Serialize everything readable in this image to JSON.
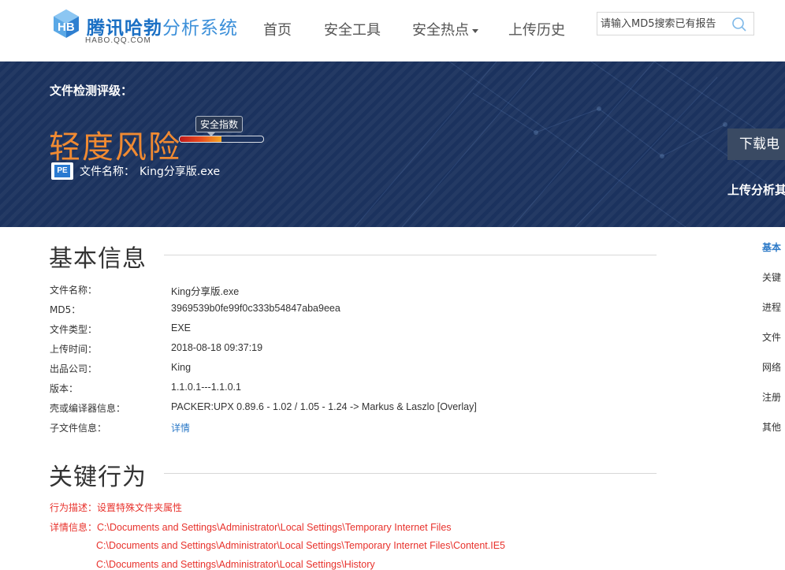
{
  "brand": {
    "title_a": "腾讯哈勃",
    "title_b": "分析系统",
    "subtitle": "HABO.QQ.COM"
  },
  "nav": {
    "items": [
      "首页",
      "安全工具",
      "安全热点",
      "上传历史"
    ]
  },
  "search": {
    "placeholder": "请输入MD5搜索已有报告",
    "value": ""
  },
  "banner": {
    "label": "文件检测评级：",
    "risk_level": "轻度风险",
    "index_tag": "安全指数",
    "index_level": 0.5,
    "file_label": "文件名称：",
    "file_name": "King分享版.exe",
    "file_icon_text": "PE",
    "download_label": "下载电",
    "upload_label": "上传分析其"
  },
  "basic": {
    "title": "基本信息",
    "rows": [
      {
        "key": "文件名称：",
        "value": "King分享版.exe"
      },
      {
        "key": "MD5：",
        "value": "3969539b0fe99f0c333b54847aba9eea"
      },
      {
        "key": "文件类型：",
        "value": "EXE"
      },
      {
        "key": "上传时间：",
        "value": "2018-08-18 09:37:19"
      },
      {
        "key": "出品公司：",
        "value": "King"
      },
      {
        "key": "版本：",
        "value": "1.1.0.1---1.1.0.1"
      },
      {
        "key": "壳或编译器信息：",
        "value": "PACKER:UPX 0.89.6 - 1.02 / 1.05 - 1.24 -> Markus & Laszlo [Overlay]"
      },
      {
        "key": "子文件信息：",
        "value": "详情"
      }
    ]
  },
  "behavior": {
    "title": "关键行为",
    "desc_label": "行为描述：",
    "desc_value": "设置特殊文件夹属性",
    "detail_label": "详情信息：",
    "paths": [
      "C:\\Documents and Settings\\Administrator\\Local Settings\\Temporary Internet Files",
      "C:\\Documents and Settings\\Administrator\\Local Settings\\Temporary Internet Files\\Content.IE5",
      "C:\\Documents and Settings\\Administrator\\Local Settings\\History"
    ]
  },
  "sidebar": {
    "items": [
      "基本",
      "关键",
      "进程",
      "文件",
      "网络",
      "注册",
      "其他"
    ]
  },
  "colors": {
    "brand_blue": "#1a6fc4",
    "banner_bg": "#1b325e",
    "risk_orange": "#f08a32",
    "alert_red": "#e8322c",
    "link_blue": "#2a78c7"
  }
}
